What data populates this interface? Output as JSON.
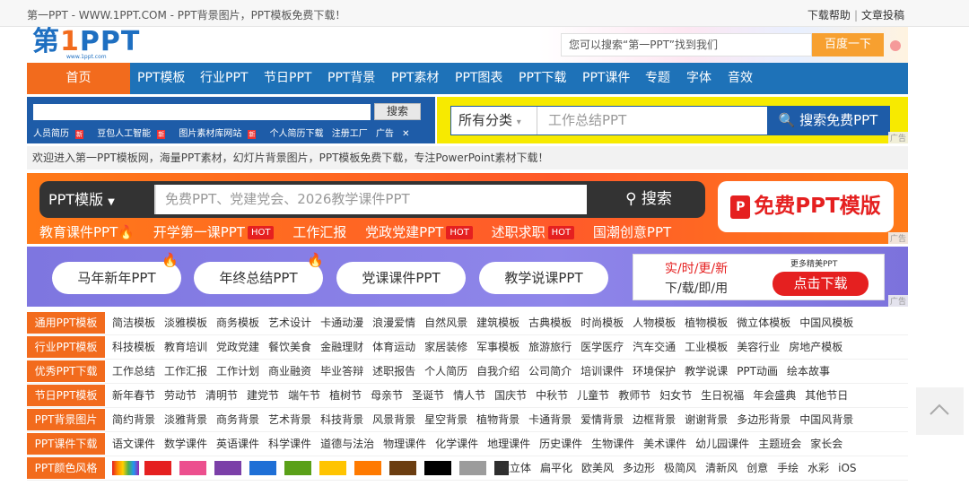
{
  "top": {
    "site_title": "第一PPT - WWW.1PPT.COM - PPT背景图片，PPT模板免费下载！",
    "help": "下载帮助",
    "contribute": "文章投稿",
    "sep": "|"
  },
  "logo": {
    "main_a": "第",
    "main_b": "1",
    "main_c": "PPT",
    "url": "www.1ppt.com"
  },
  "header_search": {
    "placeholder": "您可以搜索“第一PPT”找到我们",
    "button": "百度一下"
  },
  "nav": [
    "首页",
    "PPT模板",
    "行业PPT",
    "节日PPT",
    "PPT背景",
    "PPT素材",
    "PPT图表",
    "PPT下载",
    "PPT课件",
    "专题",
    "字体",
    "音效"
  ],
  "ad_left": {
    "button": "搜索",
    "links": [
      "人员简历",
      "豆包人工智能",
      "图片素材库网站",
      "个人简历下载",
      "注册工厂"
    ],
    "new_label": "新",
    "ad_mark": "广告"
  },
  "ad_right": {
    "select": "所有分类",
    "placeholder": "工作总结PPT",
    "button": "搜索免费PPT",
    "ad_mark": "广告"
  },
  "welcome": "欢迎进入第一PPT模板网，海量PPT素材，幻灯片背景图片，PPT模板免费下载，专注PowerPoint素材下载！",
  "banner1": {
    "select": "PPT模版",
    "placeholder": "免费PPT、党建党会、2026教学课件PPT",
    "button": "搜索",
    "free_mark": "P",
    "free": "免费PPT模版",
    "hot": "HOT",
    "tags": [
      {
        "text": "教育课件PPT🔥",
        "hot": false
      },
      {
        "text": "开学第一课PPT",
        "hot": true
      },
      {
        "text": "工作汇报",
        "hot": false
      },
      {
        "text": "党政党建PPT",
        "hot": true
      },
      {
        "text": "述职求职",
        "hot": true
      },
      {
        "text": "国潮创意PPT",
        "hot": false
      }
    ],
    "ad_mark": "广告"
  },
  "banner2": {
    "pills": [
      "马年新年PPT",
      "年终总结PPT",
      "党课课件PPT",
      "教学说课PPT"
    ],
    "ad_line1": "实/时/更/新",
    "ad_line2": "下/载/即/用",
    "ad_more": "更多精美PPT",
    "ad_button": "点击下载",
    "ad_mark": "广告"
  },
  "categories": [
    {
      "label": "通用PPT模板",
      "links": [
        "简洁模板",
        "淡雅模板",
        "商务模板",
        "艺术设计",
        "卡通动漫",
        "浪漫爱情",
        "自然风景",
        "建筑模板",
        "古典模板",
        "时尚模板",
        "人物模板",
        "植物模板",
        "微立体模板",
        "中国风模板"
      ]
    },
    {
      "label": "行业PPT模板",
      "links": [
        "科技模板",
        "教育培训",
        "党政党建",
        "餐饮美食",
        "金融理财",
        "体育运动",
        "家居装修",
        "军事模板",
        "旅游旅行",
        "医学医疗",
        "汽车交通",
        "工业模板",
        "美容行业",
        "房地产模板"
      ]
    },
    {
      "label": "优秀PPT下载",
      "links": [
        "工作总结",
        "工作汇报",
        "工作计划",
        "商业融资",
        "毕业答辩",
        "述职报告",
        "个人简历",
        "自我介绍",
        "公司简介",
        "培训课件",
        "环境保护",
        "教学说课",
        "PPT动画",
        "绘本故事"
      ]
    },
    {
      "label": "节日PPT模板",
      "links": [
        "新年春节",
        "劳动节",
        "清明节",
        "建党节",
        "端午节",
        "植树节",
        "母亲节",
        "圣诞节",
        "情人节",
        "国庆节",
        "中秋节",
        "儿童节",
        "教师节",
        "妇女节",
        "生日祝福",
        "年会盛典",
        "其他节日"
      ]
    },
    {
      "label": "PPT背景图片",
      "links": [
        "简约背景",
        "淡雅背景",
        "商务背景",
        "艺术背景",
        "科技背景",
        "风景背景",
        "星空背景",
        "植物背景",
        "卡通背景",
        "爱情背景",
        "边框背景",
        "谢谢背景",
        "多边形背景",
        "中国风背景"
      ]
    },
    {
      "label": "PPT课件下载",
      "links": [
        "语文课件",
        "数学课件",
        "英语课件",
        "科学课件",
        "道德与法治",
        "物理课件",
        "化学课件",
        "地理课件",
        "历史课件",
        "生物课件",
        "美术课件",
        "幼儿园课件",
        "主题班会",
        "家长会"
      ]
    },
    {
      "label": "PPT颜色风格",
      "links": [],
      "colors": [
        "#e52020",
        "#ec4f8e",
        "#7b3fa8",
        "#1e6fd6",
        "#5aa018",
        "#ffc400",
        "#ff7a00",
        "#6b3d10",
        "#000000",
        "#9c9c9c",
        "#2e2e2e"
      ],
      "styles": [
        "微立体",
        "扁平化",
        "欧美风",
        "多边形",
        "极简风",
        "清新风",
        "创意",
        "手绘",
        "水彩",
        "iOS"
      ]
    }
  ],
  "colors": {
    "nav": "#1e72b8",
    "accent": "#f26b1d"
  }
}
